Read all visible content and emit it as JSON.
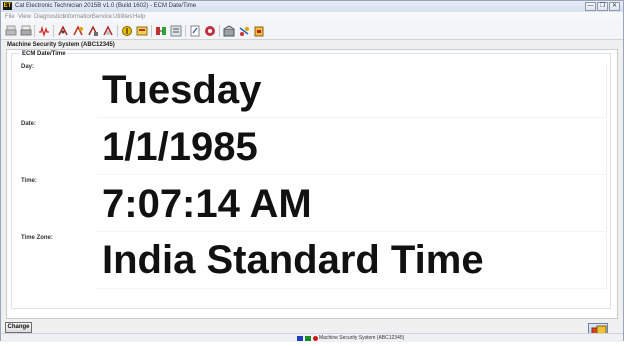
{
  "window": {
    "title": "Cat Electronic Technician 2015B v1.0 (Build 1602) - ECM Date/Time",
    "app_icon_letter": "ET",
    "controls": [
      "—",
      "❐",
      "✕"
    ]
  },
  "menu": {
    "items": [
      "File",
      "View",
      "Diagnostics",
      "Information",
      "Service",
      "Utilities",
      "Help"
    ]
  },
  "toolbar": {
    "icons": [
      "print-icon",
      "printer-icon",
      "status-icon",
      "diag-tests-icon",
      "active-codes-icon",
      "logged-codes-icon",
      "events-icon",
      "config-icon",
      "calibrations-icon",
      "flash-icon",
      "ecm-summary-icon",
      "copy-config-icon",
      "info-icon",
      "stop-icon",
      "ecm-icon",
      "help-icon",
      "exit-icon"
    ]
  },
  "screen": {
    "section_title": "Machine Security System (ABC12345)",
    "group_title": "ECM Date/Time",
    "fields": [
      {
        "label": "Day:",
        "value": "Tuesday"
      },
      {
        "label": "Date:",
        "value": "1/1/1985"
      },
      {
        "label": "Time:",
        "value": "7:07:14 AM"
      },
      {
        "label": "Time Zone:",
        "value": "India Standard Time"
      }
    ],
    "change_label": "Change"
  },
  "statusbar": {
    "text": "Machine Security System (ABC12345)",
    "colors": {
      "blue": "#1f3fb8",
      "green": "#1a8a2a",
      "red": "#d01818"
    }
  }
}
